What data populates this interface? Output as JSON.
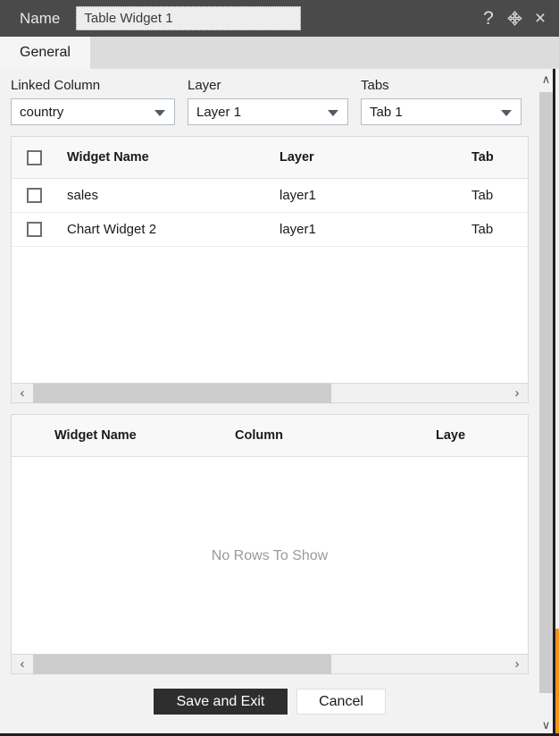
{
  "titlebar": {
    "label": "Name",
    "name_value": "Table Widget 1",
    "help_icon": "?",
    "move_icon": "move-icon",
    "close_icon": "×"
  },
  "tabs": [
    {
      "label": "General",
      "active": true
    }
  ],
  "filters": [
    {
      "label": "Linked Column",
      "value": "country"
    },
    {
      "label": "Layer",
      "value": "Layer 1"
    },
    {
      "label": "Tabs",
      "value": "Tab 1"
    }
  ],
  "widget_grid": {
    "headers": {
      "checkbox": "",
      "name": "Widget Name",
      "layer": "Layer",
      "tab": "Tab"
    },
    "rows": [
      {
        "name": "sales",
        "layer": "layer1",
        "tab": "Tab"
      },
      {
        "name": "Chart Widget 2",
        "layer": "layer1",
        "tab": "Tab"
      }
    ]
  },
  "column_grid": {
    "headers": {
      "name": "Widget Name",
      "column": "Column",
      "layer": "Laye"
    },
    "empty_message": "No Rows To Show"
  },
  "scroll": {
    "left_arrow": "‹",
    "right_arrow": "›",
    "up_arrow": "∧",
    "down_arrow": "∨"
  },
  "footer": {
    "save_label": "Save and Exit",
    "cancel_label": "Cancel"
  },
  "colors": {
    "titlebar_bg": "#4a4a4a",
    "accent": "#f79421",
    "primary_button": "#2e2e2e",
    "panel_bg": "#f2f2f2"
  }
}
